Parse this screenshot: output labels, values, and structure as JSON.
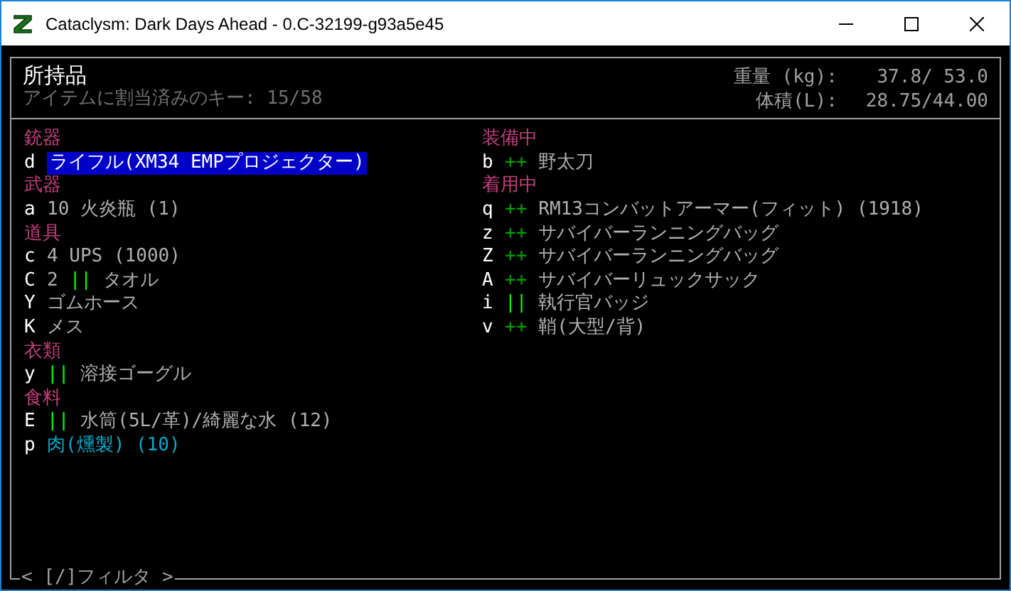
{
  "window": {
    "title": "Cataclysm: Dark Days Ahead - 0.C-32199-g93a5e45"
  },
  "header": {
    "title": "所持品",
    "keys_info": "アイテムに割当済みのキー: 15/58",
    "stats": [
      {
        "label": "重量 (kg):",
        "value": "37.8/ 53.0"
      },
      {
        "label": "体積(L):",
        "value": "28.75/44.00"
      }
    ]
  },
  "columns": [
    {
      "groups": [
        {
          "heading": "銃器",
          "items": [
            {
              "key": "d",
              "name": "ライフル(XM34 EMPプロジェクター)",
              "selected": true
            }
          ]
        },
        {
          "heading": "武器",
          "items": [
            {
              "key": "a",
              "name": "10 火炎瓶 (1)",
              "selected": false,
              "color": "#b0b0b0"
            }
          ]
        },
        {
          "heading": "道具",
          "items": [
            {
              "key": "c",
              "name": "4 UPS (1000)",
              "selected": false,
              "color": "#b0b0b0"
            },
            {
              "key": "C",
              "count": "2",
              "marker": {
                "text": "||",
                "color": "#00ff00"
              },
              "name": "タオル",
              "selected": false,
              "color": "#b0b0b0"
            },
            {
              "key": "Y",
              "name": "ゴムホース",
              "selected": false,
              "color": "#b0b0b0"
            },
            {
              "key": "K",
              "name": "メス",
              "selected": false,
              "color": "#b0b0b0"
            }
          ]
        },
        {
          "heading": "衣類",
          "items": [
            {
              "key": "y",
              "marker": {
                "text": "||",
                "color": "#00ff00"
              },
              "name": "溶接ゴーグル",
              "selected": false,
              "color": "#b0b0b0"
            }
          ]
        },
        {
          "heading": "食料",
          "items": [
            {
              "key": "E",
              "marker": {
                "text": "||",
                "color": "#00ff00"
              },
              "name": "水筒(5L/革)/綺麗な水 (12)",
              "selected": false,
              "color": "#b0b0b0"
            },
            {
              "key": "p",
              "name": "肉(燻製) (10)",
              "selected": false,
              "color": "#00aacc"
            }
          ]
        }
      ]
    },
    {
      "groups": [
        {
          "heading": "装備中",
          "items": [
            {
              "key": "b",
              "marker": {
                "text": "++",
                "color": "#00a000"
              },
              "name": "野太刀",
              "selected": false,
              "color": "#b0b0b0"
            }
          ]
        },
        {
          "heading": "着用中",
          "items": [
            {
              "key": "q",
              "marker": {
                "text": "++",
                "color": "#00a000"
              },
              "name": "RM13コンバットアーマー(フィット) (1918)",
              "selected": false,
              "color": "#b0b0b0"
            },
            {
              "key": "z",
              "marker": {
                "text": "++",
                "color": "#00a000"
              },
              "name": "サバイバーランニングバッグ",
              "selected": false,
              "color": "#b0b0b0"
            },
            {
              "key": "Z",
              "marker": {
                "text": "++",
                "color": "#00a000"
              },
              "name": "サバイバーランニングバッグ",
              "selected": false,
              "color": "#b0b0b0"
            },
            {
              "key": "A",
              "marker": {
                "text": "++",
                "color": "#00a000"
              },
              "name": "サバイバーリュックサック",
              "selected": false,
              "color": "#b0b0b0"
            },
            {
              "key": "i",
              "marker": {
                "text": "||",
                "color": "#00ff00"
              },
              "name": "執行官バッジ",
              "selected": false,
              "color": "#b0b0b0"
            },
            {
              "key": "v",
              "marker": {
                "text": "++",
                "color": "#00a000"
              },
              "name": "鞘(大型/背)",
              "selected": false,
              "color": "#b0b0b0"
            }
          ]
        }
      ]
    }
  ],
  "footer": {
    "filter": "< [/]フィルタ >"
  }
}
